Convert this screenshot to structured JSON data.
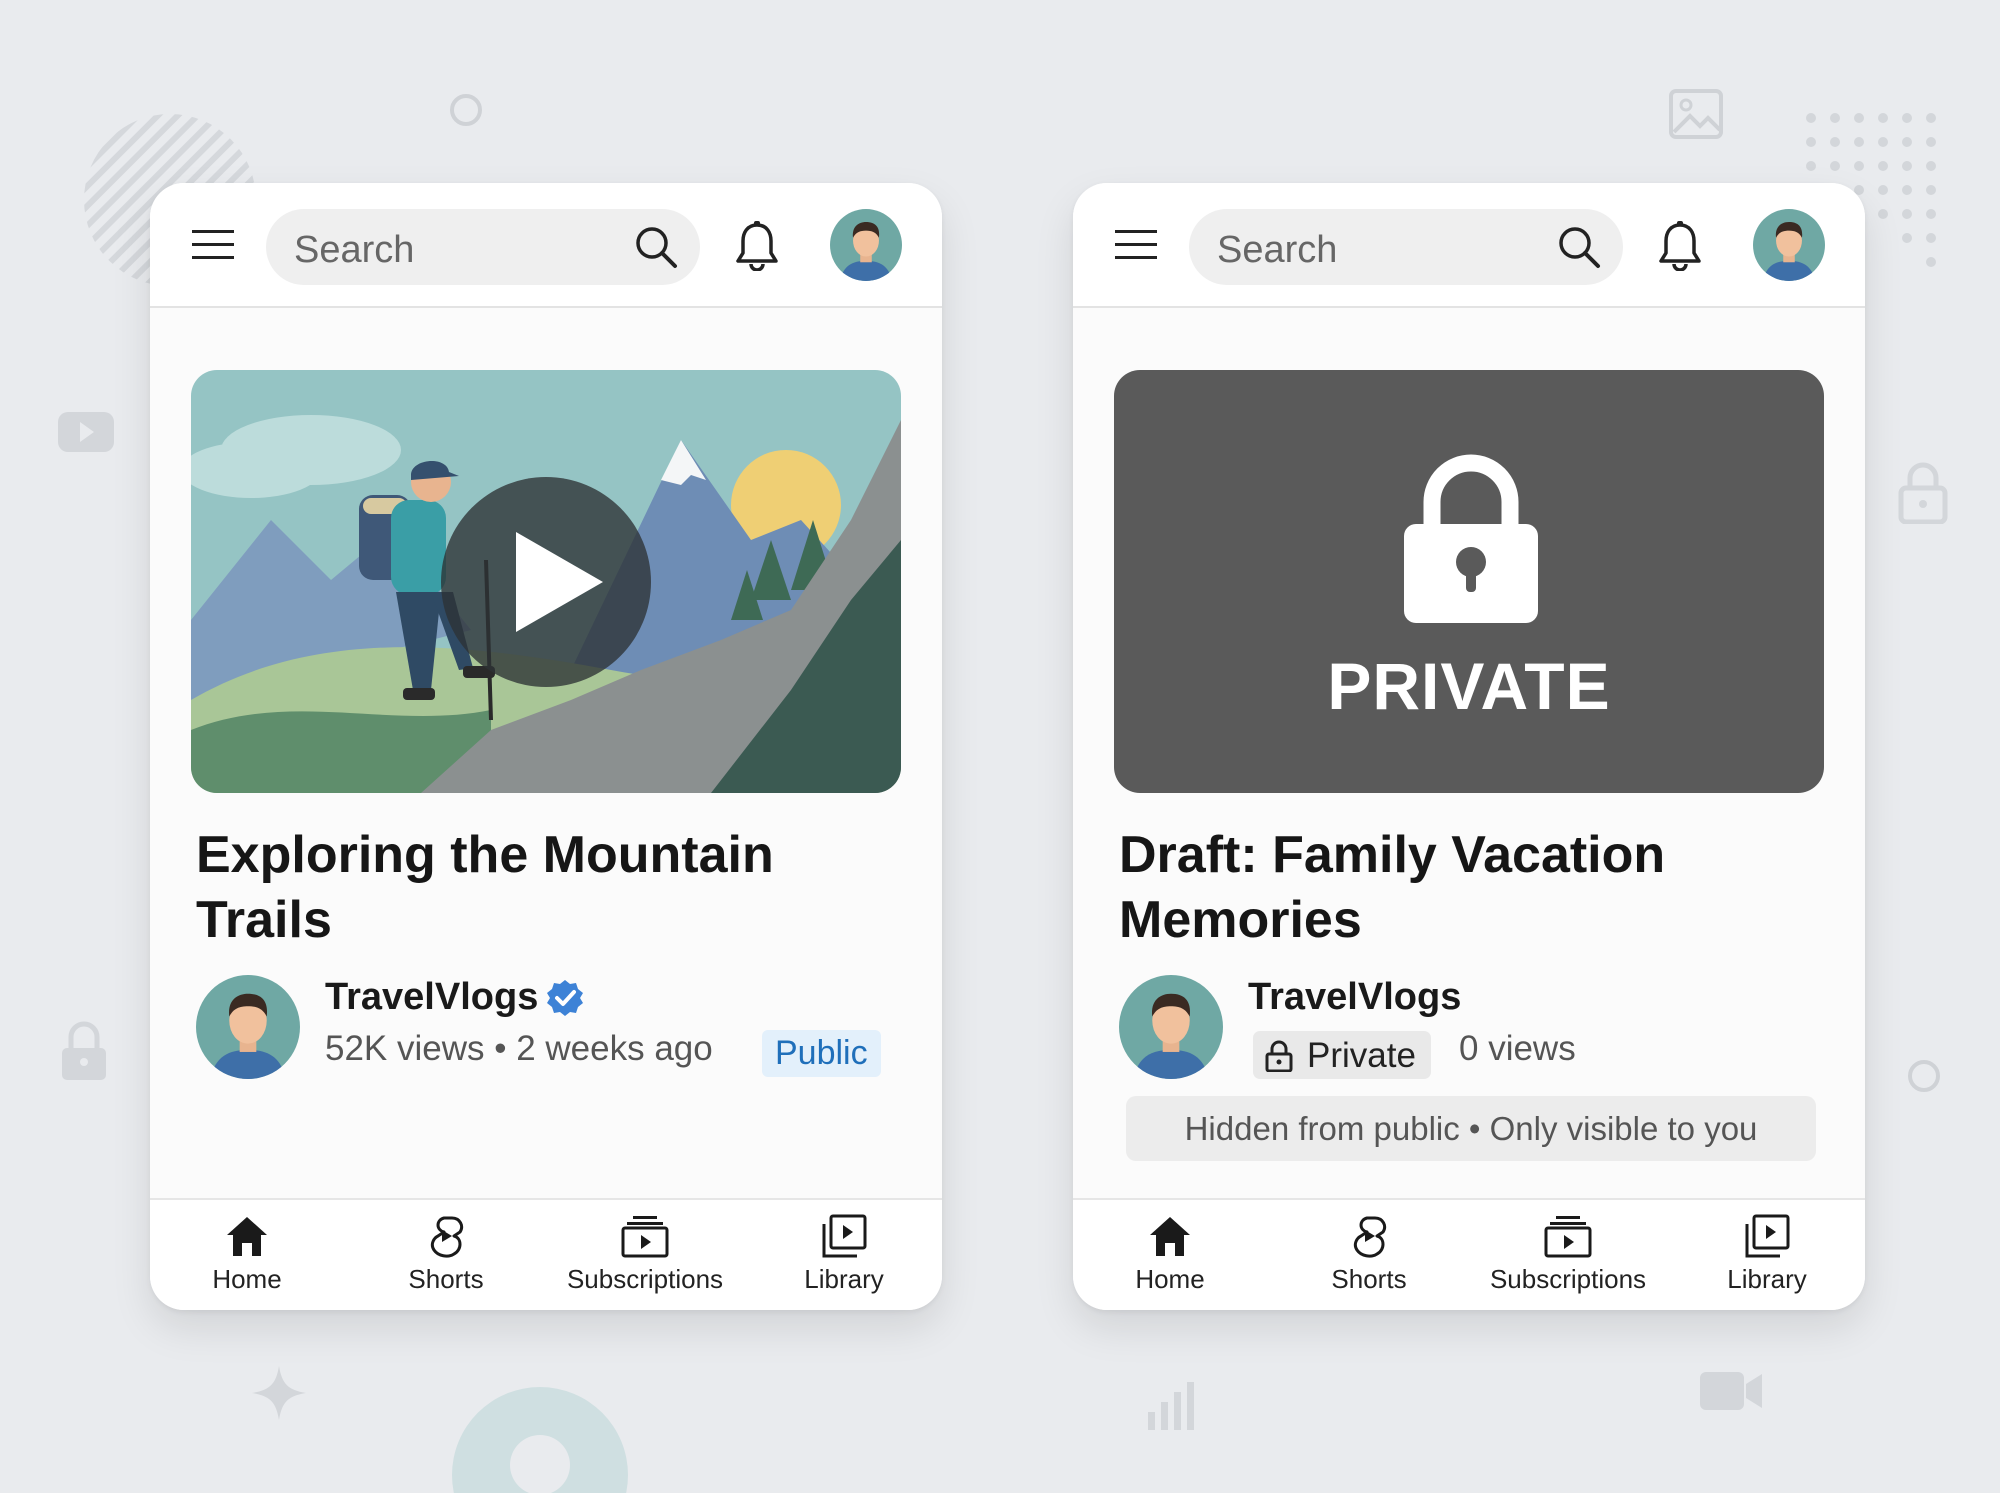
{
  "screens": [
    {
      "topbar": {
        "search_placeholder": "Search"
      },
      "video": {
        "title_line1": "Exploring the Mountain",
        "title_line2": "Trails",
        "channel": "TravelVlogs",
        "meta": "52K views • 2 weeks ago",
        "visibility": "Public"
      },
      "nav": [
        "Home",
        "Shorts",
        "Subscriptions",
        "Library"
      ]
    },
    {
      "topbar": {
        "search_placeholder": "Search"
      },
      "video": {
        "thumbnail_label": "PRIVATE",
        "title_line1": "Draft: Family Vacation",
        "title_line2": "Memories",
        "channel": "TravelVlogs",
        "visibility": "Private",
        "views": "0 views",
        "notice": "Hidden from public • Only visible to you"
      },
      "nav": [
        "Home",
        "Shorts",
        "Subscriptions",
        "Library"
      ]
    }
  ],
  "colors": {
    "background": "#e9ebee",
    "public_badge": "#1f6fba",
    "private_thumb": "#5a5a5a",
    "verified": "#3d82d6"
  }
}
